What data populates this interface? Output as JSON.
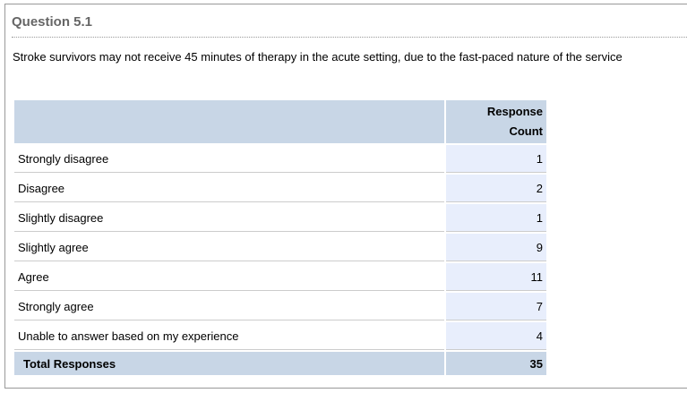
{
  "question": {
    "title": "Question 5.1",
    "text": "Stroke survivors may not receive 45 minutes of therapy in the acute setting, due to the fast-paced nature of the service"
  },
  "table": {
    "header": {
      "label": "",
      "count_line1": "Response",
      "count_line2": "Count"
    },
    "rows": [
      {
        "label": "Strongly disagree",
        "count": "1"
      },
      {
        "label": "Disagree",
        "count": "2"
      },
      {
        "label": "Slightly disagree",
        "count": "1"
      },
      {
        "label": "Slightly agree",
        "count": "9"
      },
      {
        "label": "Agree",
        "count": "11"
      },
      {
        "label": "Strongly agree",
        "count": "7"
      },
      {
        "label": "Unable to answer based on my experience",
        "count": "4"
      }
    ],
    "total": {
      "label": "Total Responses",
      "count": "35"
    }
  },
  "colors": {
    "header_bg": "#c8d6e6",
    "count_cell_bg": "#e8eefc",
    "title_color": "#666666"
  }
}
